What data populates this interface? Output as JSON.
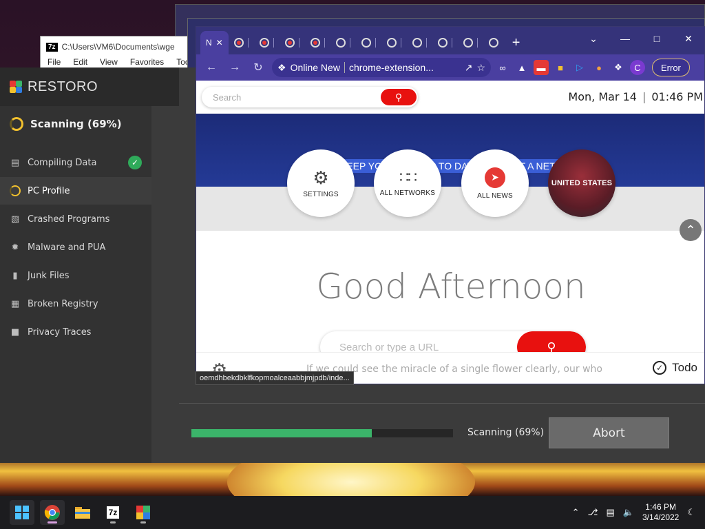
{
  "zip_window": {
    "logo": "7z",
    "path": "C:\\Users\\VM6\\Documents\\wge",
    "menu": [
      "File",
      "Edit",
      "View",
      "Favorites",
      "Too"
    ]
  },
  "restoro": {
    "brand": "RESTORO",
    "scan_heading": "Scanning (69%)",
    "items": [
      {
        "label": "Compiling Data",
        "icon": "bar-chart-icon",
        "state": "done"
      },
      {
        "label": "PC Profile",
        "icon": "loading-ring-icon",
        "state": "active"
      },
      {
        "label": "Crashed Programs",
        "icon": "crashed-window-icon",
        "state": "pending"
      },
      {
        "label": "Malware and PUA",
        "icon": "bug-icon",
        "state": "pending"
      },
      {
        "label": "Junk Files",
        "icon": "trash-icon",
        "state": "pending"
      },
      {
        "label": "Broken Registry",
        "icon": "registry-icon",
        "state": "pending"
      },
      {
        "label": "Privacy Traces",
        "icon": "lock-icon",
        "state": "pending"
      }
    ],
    "progress_percent": 69,
    "progress_text": "Scanning (69%)",
    "abort_label": "Abort"
  },
  "chrome": {
    "active_tab_label": "N",
    "omnibox_site": "Online New",
    "omnibox_url": "chrome-extension...",
    "error_label": "Error",
    "profile_initial": "C",
    "page": {
      "search_placeholder": "Search",
      "date": "Mon, Mar 14",
      "time": "01:46 PM",
      "banner_title": "KEEP YOURSELF UP TO DATE - SELECT A NETWORK",
      "circles": [
        {
          "label": "SETTINGS",
          "icon": "settings-gear-icon"
        },
        {
          "label": "ALL NETWORKS",
          "icon": "grid-icon"
        },
        {
          "label": "ALL NEWS",
          "icon": "megaphone-icon"
        },
        {
          "label": "UNITED STATES",
          "icon": "flag-icon"
        }
      ],
      "greeting": "Good Afternoon",
      "url_placeholder": "Search or type a URL",
      "quote": "If we could see the miracle of a single flower clearly, our who",
      "todo_label": "Todo"
    },
    "status_url": "oemdhbekdbklfkopmoalceaabbjmjpdb/inde..."
  },
  "taskbar": {
    "time": "1:46 PM",
    "date": "3/14/2022",
    "zip_label": "7z"
  },
  "colors": {
    "restoro_green": "#3bb46a",
    "restoro_yellow": "#f2c12e",
    "chrome_purple": "#4a3fa0",
    "accent_red": "#e8110f"
  }
}
